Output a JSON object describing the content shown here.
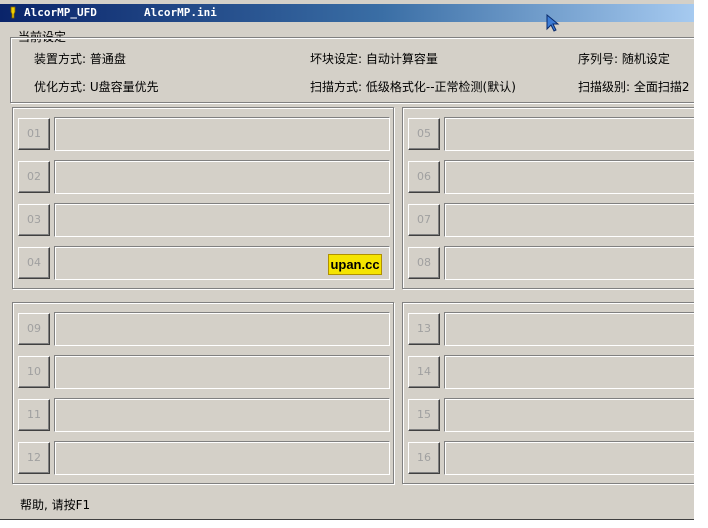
{
  "window": {
    "title_left": "AlcorMP_UFD",
    "title_right": "AlcorMP.ini"
  },
  "settings": {
    "title": "当前设定",
    "device_mode": "装置方式: 普通盘",
    "bad_block": "坏块设定: 自动计算容量",
    "serial": "序列号: 随机设定",
    "optimize": "优化方式: U盘容量优先",
    "scan_mode": "扫描方式: 低级格式化--正常检测(默认)",
    "scan_level": "扫描级别: 全面扫描2 ("
  },
  "ports": [
    "01",
    "02",
    "03",
    "04",
    "05",
    "06",
    "07",
    "08",
    "09",
    "10",
    "11",
    "12",
    "13",
    "14",
    "15",
    "16"
  ],
  "watermark": "upan.cc",
  "status": {
    "help_text": "帮助, 请按F1"
  },
  "colors": {
    "face": "#d4d0c8",
    "title_start": "#0a246a",
    "title_end": "#a6caf0",
    "watermark_bg": "#f5e400"
  }
}
